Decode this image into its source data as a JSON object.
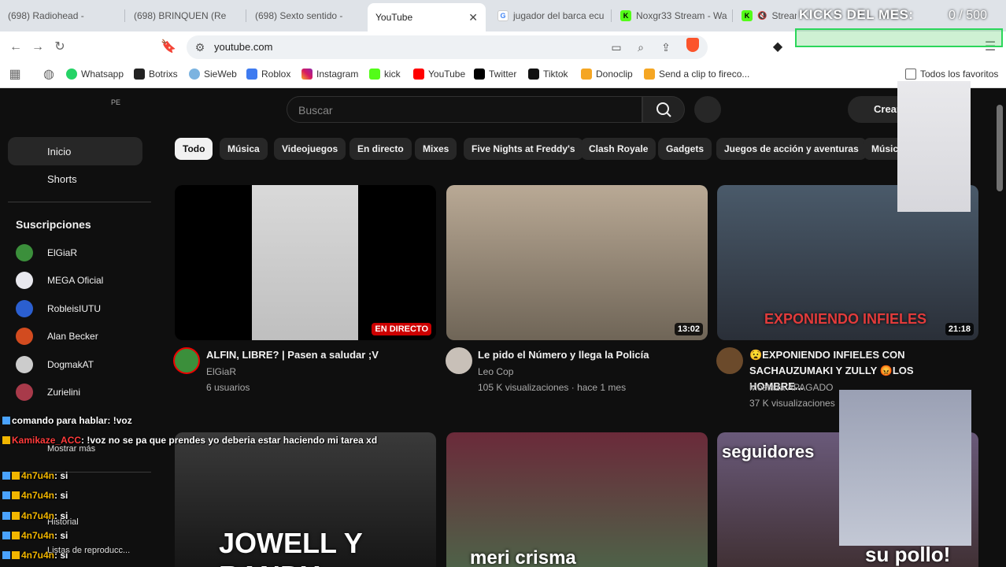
{
  "browser": {
    "tabs": [
      {
        "title": "(698) Radiohead -",
        "icon": "youtube-icon",
        "active": false
      },
      {
        "title": "(698) BRINQUEN (Re",
        "icon": "youtube-icon",
        "active": false
      },
      {
        "title": "(698) Sexto sentido -",
        "icon": "youtube-icon",
        "active": false
      },
      {
        "title": "YouTube",
        "icon": "youtube-icon",
        "active": true
      },
      {
        "title": "jugador del barca ecu",
        "icon": "google-icon",
        "active": false
      },
      {
        "title": "Noxgr33 Stream - Wa",
        "icon": "kick-icon",
        "active": false
      },
      {
        "title": "Stream",
        "icon": "kick-icon",
        "active": false
      }
    ],
    "url": "youtube.com",
    "bookmarks": [
      "Whatsapp",
      "Botrixs",
      "SieWeb",
      "Roblox",
      "Instagram",
      "kick",
      "YouTube",
      "Twitter",
      "Tiktok",
      "Donoclip",
      "Send a clip to fireco..."
    ],
    "all_bookmarks": "Todos los favoritos",
    "brave_count": "5"
  },
  "overlay": {
    "title": "KICKS DEL MES:",
    "count": "0   / 500"
  },
  "youtube": {
    "country": "PE",
    "search_placeholder": "Buscar",
    "create_label": "Crear",
    "sidebar": {
      "home": "Inicio",
      "shorts": "Shorts",
      "subs_heading": "Suscripciones",
      "subscriptions": [
        "ElGiaR",
        "MEGA Oficial",
        "RobleisIUTU",
        "Alan Becker",
        "DogmakAT",
        "Zurielini"
      ],
      "show_more": "Mostrar más",
      "history": "Historial",
      "playlists": "Listas de reproducc..."
    },
    "chips": [
      "Todo",
      "Música",
      "Videojuegos",
      "En directo",
      "Mixes",
      "Five Nights at Freddy's",
      "Clash Royale",
      "Gadgets",
      "Juegos de acción y aventuras",
      "Músic"
    ],
    "videos": [
      {
        "title": "ALFIN, LIBRE? | Pasen a saludar ;V",
        "channel": "ElGiaR",
        "meta": "6 usuarios",
        "badge": "EN DIRECTO"
      },
      {
        "title": "Le pido el Número y llega la Policía",
        "channel": "Leo Cop",
        "meta": "105 K visualizaciones · hace 1 mes",
        "badge": "13:02"
      },
      {
        "title": "😧EXPONIENDO INFIELES CON SACHAUZUMAKI Y ZULLY 😡LOS HOMBRE...",
        "channel": "Mostaza APAGADO",
        "meta": "37 K visualizaciones",
        "badge": "21:18",
        "thumb_text": "EXPONIENDO INFIELES"
      }
    ],
    "row2_thumb_texts": [
      "JOWELL Y RANDY",
      "meri crisma",
      "seguidores",
      "su pollo!"
    ]
  },
  "chat": [
    {
      "user": "",
      "text": "comando para hablar: !voz"
    },
    {
      "user": "Kamikaze_ACC",
      "text": ": !voz no se pa que prendes yo deberia estar haciendo mi tarea xd"
    },
    {
      "user": "4n7u4n",
      "text": ": si"
    },
    {
      "user": "4n7u4n",
      "text": ": si"
    },
    {
      "user": "4n7u4n",
      "text": ": si"
    },
    {
      "user": "4n7u4n",
      "text": ": si"
    },
    {
      "user": "4n7u4n",
      "text": ": si"
    }
  ]
}
